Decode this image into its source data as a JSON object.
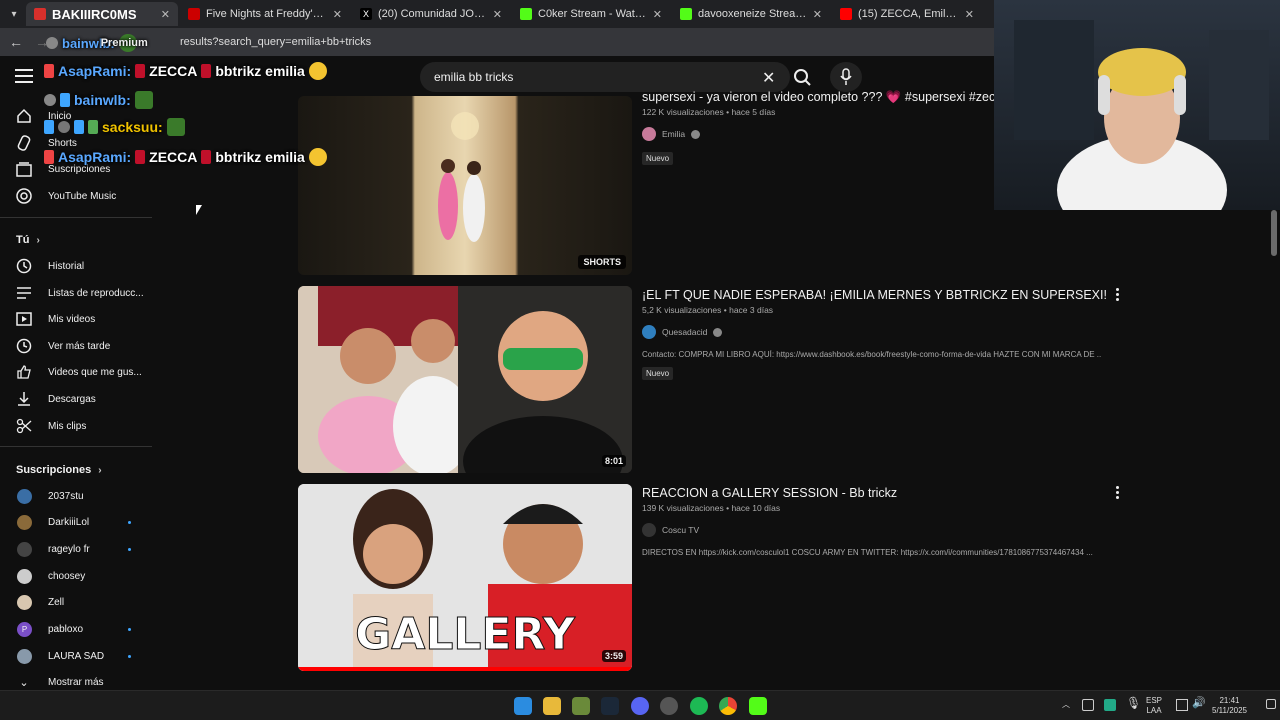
{
  "browser": {
    "tabs": [
      {
        "title": "BAKIIIRC0MS",
        "active": true,
        "color": "#d9302c"
      },
      {
        "title": "Five Nights at Freddy's 2 | Tráil",
        "color": "#cc0000"
      },
      {
        "title": "(20) Comunidad JOSEO EXCLU",
        "color": "#111111"
      },
      {
        "title": "C0ker Stream - Watch Live on K",
        "color": "#53fc18"
      },
      {
        "title": "davooxeneize Stream - Watch L",
        "color": "#53fc18"
      },
      {
        "title": "(15) ZECCA, Emilia, Bb trickz - (",
        "color": "#ff0000"
      }
    ],
    "url": "results?search_query=emilia+bb+tricks"
  },
  "youtube": {
    "search": {
      "value": "emilia bb tricks"
    },
    "sidebar": {
      "main": [
        {
          "label": "Inicio",
          "icon": "home-icon"
        },
        {
          "label": "Shorts",
          "icon": "shorts-icon"
        },
        {
          "label": "Suscripciones",
          "icon": "subscriptions-icon"
        },
        {
          "label": "YouTube Music",
          "icon": "music-icon"
        }
      ],
      "you_title": "Tú",
      "you": [
        {
          "label": "Historial",
          "icon": "history-icon"
        },
        {
          "label": "Listas de reproducc...",
          "icon": "playlist-icon"
        },
        {
          "label": "Mis videos",
          "icon": "video-icon"
        },
        {
          "label": "Ver más tarde",
          "icon": "clock-icon"
        },
        {
          "label": "Videos que me gus...",
          "icon": "like-icon"
        },
        {
          "label": "Descargas",
          "icon": "download-icon"
        },
        {
          "label": "Mis clips",
          "icon": "scissors-icon"
        }
      ],
      "subs_title": "Suscripciones",
      "subs": [
        {
          "label": "2037stu",
          "color": "#3a6ea5",
          "dot": false
        },
        {
          "label": "DarkiiiLol",
          "color": "#8a6a3a",
          "dot": true
        },
        {
          "label": "rageylo fr",
          "color": "#444444",
          "dot": true
        },
        {
          "label": "choosey",
          "color": "#cccccc",
          "dot": false
        },
        {
          "label": "Zell",
          "color": "#d8c7b0",
          "dot": false
        },
        {
          "label": "pabloxo",
          "color": "#7a4fc7",
          "dot": true,
          "letter": "P"
        },
        {
          "label": "LAURA SAD",
          "color": "#8899aa",
          "dot": true
        }
      ],
      "show_more": "Mostrar más"
    },
    "videos": [
      {
        "title": "supersexi - ya vieron el video completo ??? 💗 #supersexi #zecca",
        "views": "122 K visualizaciones",
        "age": "hace 5 días",
        "channel": "Emilia",
        "badge_new": "Nuevo",
        "overlay": "SHORTS",
        "description": ""
      },
      {
        "title": "¡EL FT QUE NADIE ESPERABA! ¡EMILIA MERNES Y BBTRICKZ EN SUPERSEXI!",
        "views": "5,2 K visualizaciones",
        "age": "hace 3 días",
        "channel": "Quesadacid",
        "badge_new": "Nuevo",
        "overlay": "8:01",
        "description": "Contacto: COMPRA MI LIBRO AQUÍ: https://www.dashbook.es/book/freestyle-como-forma-de-vida HAZTE CON MI MARCA DE ..."
      },
      {
        "title": "REACCION a GALLERY SESSION - Bb trickz",
        "views": "139 K visualizaciones",
        "age": "hace 10 días",
        "channel": "Coscu TV",
        "badge_new": "",
        "overlay": "3:59",
        "description": "DIRECTOS EN https://kick.com/cosculol1 COSCU ARMY EN TWITTER: https://x.com/i/communities/1781086775374467434 ..."
      }
    ]
  },
  "chat": [
    {
      "user": "AsapRami:",
      "msg": "ZECCA",
      "msg2": "bbtrikz emilia"
    },
    {
      "user": "bainwlb:",
      "msg": ""
    },
    {
      "user": "bainwlb:",
      "msg": ""
    },
    {
      "user": "sacksuu:",
      "msg": ""
    },
    {
      "user": "AsapRami:",
      "msg": "ZECCA",
      "msg2": "bbtrikz emilia"
    }
  ],
  "chat_overlay_words": {
    "premium": "Premium"
  },
  "taskbar": {
    "lang": "ESP",
    "lang2": "LAA",
    "time": "21:41",
    "date": "5/11/2025"
  },
  "colors": {
    "accent": "#ff0000",
    "kick": "#53fc18",
    "link": "#3ea6ff"
  }
}
